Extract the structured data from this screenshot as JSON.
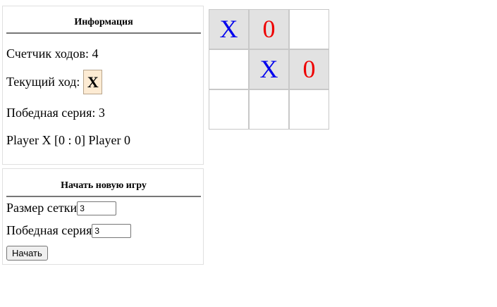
{
  "info": {
    "title": "Информация",
    "move_count": "Счетчик ходов: 4",
    "current_turn_label": "Текущий ход:",
    "current_turn_value": "X",
    "win_streak": "Победная серия: 3",
    "score": "Player X [0 : 0] Player 0"
  },
  "new_game": {
    "title": "Начать новую игру",
    "grid_size_label": "Размер сетки",
    "grid_size_value": "3",
    "win_length_label": "Победная серия",
    "win_length_value": "3",
    "start_label": "Начать"
  },
  "colors": {
    "x_mark": "#0000ee",
    "o_mark": "#ee0000",
    "filled_cell": "#e2e2e2",
    "turn_badge": "#fdebd3"
  },
  "board": {
    "size": 3,
    "cells": [
      [
        "X",
        "0",
        ""
      ],
      [
        "",
        "X",
        "0"
      ],
      [
        "",
        "",
        ""
      ]
    ]
  }
}
